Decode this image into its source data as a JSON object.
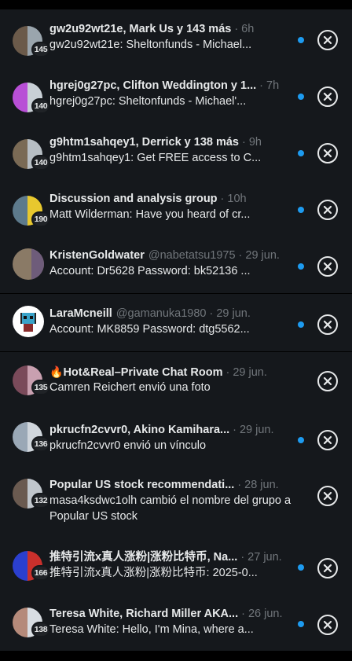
{
  "conversations": [
    {
      "name": "gw2u92wt21e, Mark Us y 143 más",
      "handle": "",
      "sep": "·",
      "time": "6h",
      "preview": "gw2u92wt21e: Sheltonfunds - Michael...",
      "count": "145",
      "avatar_colors": [
        "#6b5a4a",
        "#9aa5ad"
      ]
    },
    {
      "name": "hgrej0g27pc, Clifton Weddington y 1...",
      "handle": "",
      "sep": "·",
      "time": "7h",
      "preview": "hgrej0g27pc: Sheltonfunds - Michael'...",
      "count": "140",
      "avatar_colors": [
        "#b84fd6",
        "#c9d0d6"
      ]
    },
    {
      "name": "g9htm1sahqey1, Derrick y 138 más",
      "handle": "",
      "sep": "·",
      "time": "9h",
      "preview": "g9htm1sahqey1: Get FREE access to C...",
      "count": "140",
      "avatar_colors": [
        "#7a6a55",
        "#b7bec4"
      ]
    },
    {
      "name": "Discussion and analysis group",
      "handle": "",
      "sep": "·",
      "time": "10h",
      "preview": "Matt Wilderman: Have you heard of cr...",
      "count": "190",
      "avatar_colors": [
        "#5d7a8c",
        "#e8c82e"
      ]
    },
    {
      "name": "KristenGoldwater",
      "handle": "@nabetatsu1975",
      "sep": "·",
      "time": "29 jun.",
      "preview": "Account: Dr5628 Password: bk52136 ...",
      "count": "",
      "avatar_colors": [
        "#8a7a66",
        "#6e5c7a"
      ]
    },
    {
      "name": "LaraMcneill",
      "handle": "@gamanuka1980",
      "sep": "·",
      "time": "29 jun.",
      "preview": "Account: MK8859 Password: dtg5562...",
      "count": "",
      "avatar_colors": [
        "#ffffff",
        "#ffffff"
      ]
    },
    {
      "name": "Hot&Real–Private Chat Room",
      "emoji": "🔥",
      "handle": "",
      "sep": "·",
      "time": "29 jun.",
      "preview": "Camren Reichert envió una foto",
      "count": "135",
      "avatar_colors": [
        "#7a4a5a",
        "#c9a0b0"
      ]
    },
    {
      "name": "pkrucfn2cvvr0, Akino Kamihara...",
      "handle": "",
      "sep": "·",
      "time": "29 jun.",
      "preview": "pkrucfn2cvvr0 envió un vínculo",
      "count": "136",
      "avatar_colors": [
        "#9aa8b6",
        "#d0d6dc"
      ]
    },
    {
      "name": "Popular US stock recommendati...",
      "handle": "",
      "sep": "·",
      "time": "28 jun.",
      "preview": "masa4ksdwc1olh cambió el nombre del grupo a Popular US stock",
      "count": "132",
      "avatar_colors": [
        "#6a5a50",
        "#c0c6cc"
      ]
    },
    {
      "name": "推特引流x真人涨粉|涨粉比特币, Na...",
      "handle": "",
      "sep": "·",
      "time": "27 jun.",
      "preview": "推特引流x真人涨粉|涨粉比特币: 2025-0...",
      "count": "166",
      "avatar_colors": [
        "#2b3fcf",
        "#c9302c"
      ]
    },
    {
      "name": "Teresa White, Richard Miller AKA...",
      "handle": "",
      "sep": "·",
      "time": "26 jun.",
      "preview": "Teresa White: Hello, I'm Mina, where a...",
      "count": "138",
      "avatar_colors": [
        "#b58a7a",
        "#d8dde2"
      ]
    }
  ],
  "colors": {
    "unread_dot": "#1d9bf0",
    "background": "#15181c"
  },
  "icons": {
    "close": "close-circle-icon"
  }
}
